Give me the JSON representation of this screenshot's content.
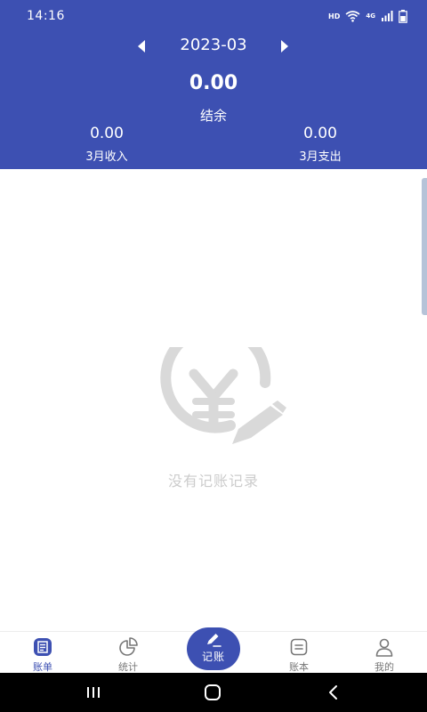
{
  "status_bar": {
    "time": "14:16",
    "hd_label": "HD",
    "network_label": "4G",
    "icons": [
      "wifi-icon",
      "signal-icon",
      "battery-icon"
    ]
  },
  "header": {
    "month": "2023-03",
    "balance_value": "0.00",
    "balance_label": "结余",
    "income_value": "0.00",
    "income_label": "3月收入",
    "expense_value": "0.00",
    "expense_label": "3月支出"
  },
  "empty_state": {
    "icon": "yen-pen-icon",
    "text": "没有记账记录"
  },
  "tabbar": {
    "items": [
      {
        "label": "账单",
        "icon": "bill-list-icon",
        "active": true
      },
      {
        "label": "统计",
        "icon": "pie-chart-icon",
        "active": false
      },
      {
        "label": "账本",
        "icon": "ledger-icon",
        "active": false
      },
      {
        "label": "我的",
        "icon": "person-icon",
        "active": false
      }
    ],
    "fab": {
      "label": "记账",
      "icon": "pen-icon"
    }
  },
  "nav_bar": {
    "icons": [
      "recents-icon",
      "home-icon",
      "back-icon"
    ]
  },
  "colors": {
    "primary": "#3d50b2",
    "empty_icon": "#d9d9d9",
    "empty_text": "#cccccc",
    "tab_inactive": "#777777"
  }
}
